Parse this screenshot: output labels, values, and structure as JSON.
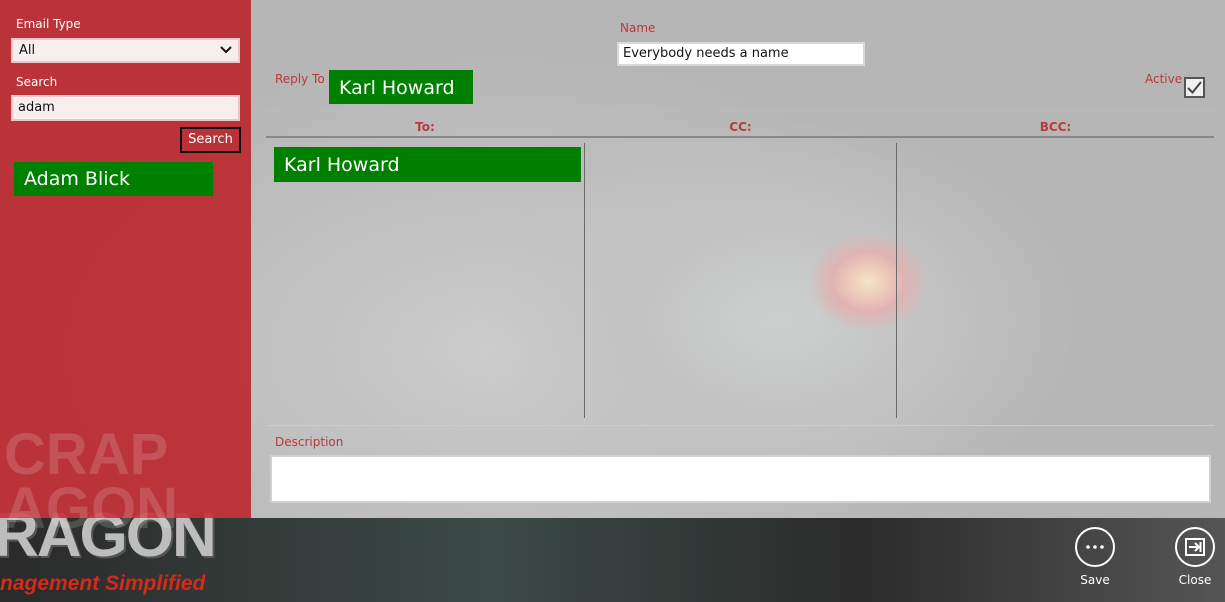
{
  "left_panel": {
    "email_type_label": "Email Type",
    "email_type_value": "All",
    "search_label": "Search",
    "search_value": "adam",
    "search_button": "Search",
    "results": [
      "Adam Blick"
    ]
  },
  "form": {
    "name_label": "Name",
    "name_value": "Everybody needs a name",
    "reply_to_label": "Reply To",
    "reply_to_value": "Karl Howard",
    "active_label": "Active",
    "active_checked": true,
    "columns": {
      "to": "To:",
      "cc": "CC:",
      "bcc": "BCC:"
    },
    "to_recipients": [
      "Karl Howard"
    ],
    "description_label": "Description",
    "description_value": ""
  },
  "branding": {
    "ghost": "CRAP\nAGON",
    "big": "RAGON",
    "sub": "nagement Simplified"
  },
  "app_bar": {
    "save_label": "Save",
    "close_label": "Close"
  },
  "colors": {
    "left_panel": "#c4343a",
    "chip_green": "#008000",
    "label_red": "#b83a3a"
  }
}
